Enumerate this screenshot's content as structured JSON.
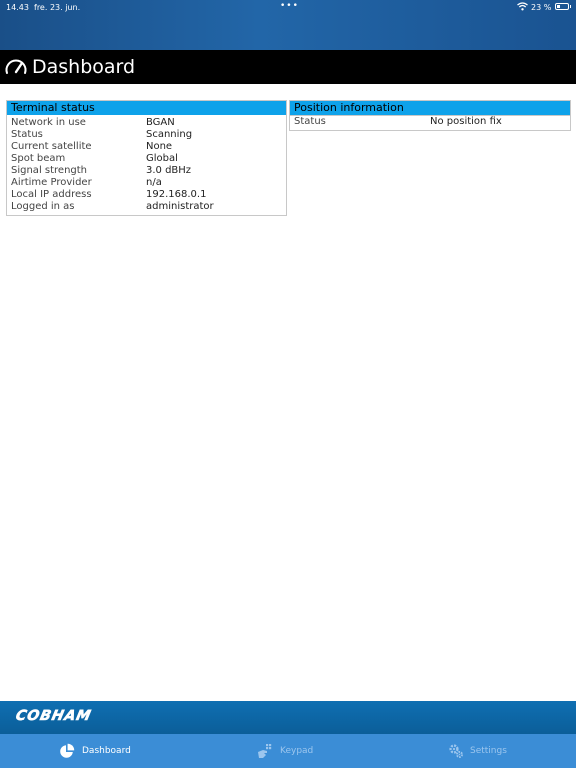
{
  "status_bar": {
    "time": "14.43",
    "date": "fre. 23. jun.",
    "dots": "•••",
    "battery": "23 %"
  },
  "header": {
    "title": "Dashboard"
  },
  "terminal_status": {
    "title": "Terminal status",
    "rows": [
      {
        "label": "Network in use",
        "value": "BGAN"
      },
      {
        "label": "Status",
        "value": "Scanning"
      },
      {
        "label": "Current satellite",
        "value": "None"
      },
      {
        "label": "Spot beam",
        "value": "Global"
      },
      {
        "label": "Signal strength",
        "value": "3.0 dBHz"
      },
      {
        "label": "Airtime Provider",
        "value": "n/a"
      },
      {
        "label": "Local IP address",
        "value": "192.168.0.1"
      },
      {
        "label": "Logged in as",
        "value": "administrator"
      }
    ]
  },
  "position_information": {
    "title": "Position information",
    "rows": [
      {
        "label": "Status",
        "value": "No position fix"
      }
    ]
  },
  "brand": {
    "logo_text": "COBHAM"
  },
  "tabs": [
    {
      "label": "Dashboard",
      "icon": "pie-chart-icon",
      "active": true
    },
    {
      "label": "Keypad",
      "icon": "keypad-hand-icon",
      "active": false
    },
    {
      "label": "Settings",
      "icon": "gears-icon",
      "active": false
    }
  ],
  "colors": {
    "panel_header": "#0ea2ea",
    "header_bar": "#000000",
    "brand_bar": "#0f6fb2",
    "tab_bar": "#3b8dd6",
    "tab_inactive_text": "#9cc6ee"
  }
}
